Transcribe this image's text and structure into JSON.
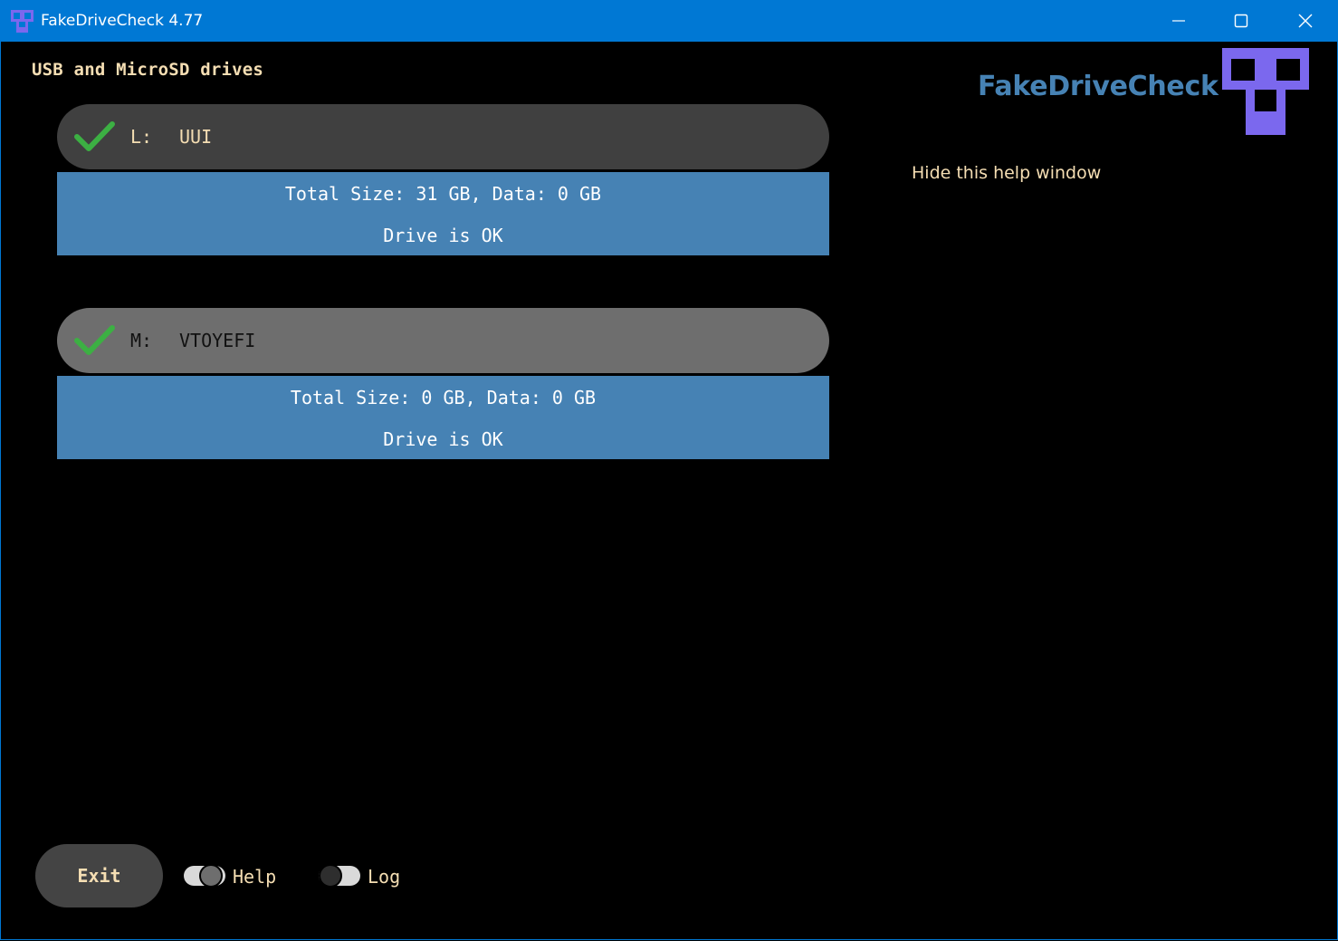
{
  "window": {
    "title": "FakeDriveCheck 4.77",
    "titlebar_color": "#0078d4",
    "icons": [
      "app-logo-icon",
      "minimize-icon",
      "maximize-icon",
      "close-icon"
    ]
  },
  "main": {
    "section_title": "USB and MicroSD drives",
    "drives": [
      {
        "letter": "L:",
        "label": "UUI",
        "status_icon": "checkmark-icon",
        "summary": "Total Size: 31 GB, Data: 0 GB",
        "status": "Drive is OK",
        "header_color": "#404040"
      },
      {
        "letter": "M:",
        "label": "VTOYEFI",
        "status_icon": "checkmark-icon",
        "summary": "Total Size: 0 GB, Data: 0 GB",
        "status": "Drive is OK",
        "header_color": "#6e6e6e"
      }
    ],
    "info_color": "#4682b4",
    "check_color": "#3cb043"
  },
  "help_panel": {
    "brand": "FakeDriveCheck",
    "brand_color": "#4682b4",
    "logo_color": "#7b68ee",
    "hide_link": "Hide this help window"
  },
  "footer": {
    "exit_label": "Exit",
    "help_toggle": {
      "label": "Help",
      "on": true
    },
    "log_toggle": {
      "label": "Log",
      "on": false
    }
  },
  "text_color": "#f5deb3"
}
